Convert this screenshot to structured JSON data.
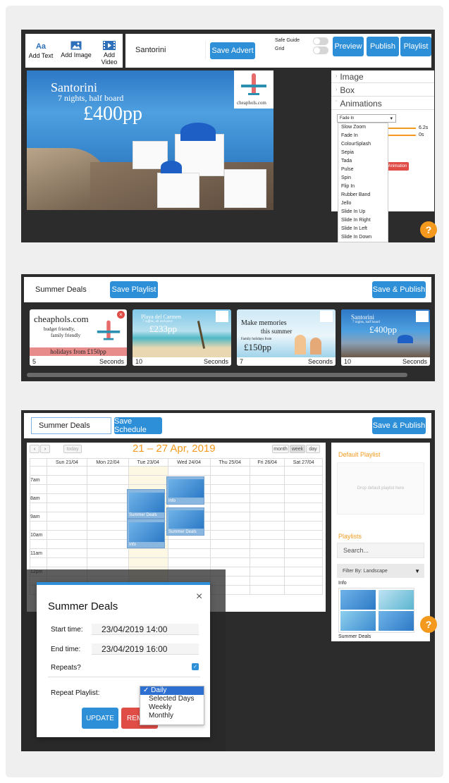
{
  "editor": {
    "tools": [
      {
        "label": "Add Text",
        "icon": "text-icon"
      },
      {
        "label": "Add Image",
        "icon": "image-icon"
      },
      {
        "label": "Add Video",
        "icon": "video-icon"
      }
    ],
    "advert_name": "Santorini",
    "save_advert": "Save Advert",
    "safe_guide": "Safe Guide",
    "grid": "Grid",
    "preview": "Preview",
    "publish": "Publish",
    "playlist": "Playlist",
    "canvas": {
      "title": "Santorini",
      "subtitle": "7 nights, half board",
      "price": "£400pp",
      "logo": "cheaphols.com"
    },
    "panel": {
      "image": "Image",
      "box": "Box",
      "animations": "Animations",
      "selected": "Fade In",
      "dur1": "6.2s",
      "dur2": "0s",
      "add_anim": "Animation",
      "options": [
        "Slow Zoom",
        "Fade In",
        "ColourSplash",
        "Sepia",
        "Tada",
        "Pulse",
        "Spin",
        "Flip In",
        "Rubber Band",
        "Jello",
        "Slide In Up",
        "Slide In Right",
        "Slide In Left",
        "Slide In Down"
      ]
    },
    "help": "?"
  },
  "playlist": {
    "name": "Summer Deals",
    "save_playlist": "Save Playlist",
    "save_publish": "Save & Publish",
    "seconds_label": "Seconds",
    "items": [
      {
        "title": "cheaphols.com",
        "line1": "budget friendly,",
        "line2": "family friendly",
        "banner": "holidays from £150pp",
        "duration": "5"
      },
      {
        "title": "Playa del Carmen",
        "line1": "7 nights, all inclusive",
        "price": "£233pp",
        "duration": "10"
      },
      {
        "title": "Make memories",
        "line1": "this summer",
        "line2": "Family holidays from",
        "price": "£150pp",
        "duration": "7"
      },
      {
        "title": "Santorini",
        "line1": "7 nights, half board",
        "price": "£400pp",
        "duration": "10"
      }
    ]
  },
  "schedule": {
    "name": "Summer Deals",
    "save_schedule": "Save Schedule",
    "save_publish": "Save & Publish",
    "today": "today",
    "range": "21 – 27 Apr, 2019",
    "views": [
      "month",
      "week",
      "day"
    ],
    "days": [
      "Sun 21/04",
      "Mon 22/04",
      "Tue 23/04",
      "Wed 24/04",
      "Thu 25/04",
      "Fri 26/04",
      "Sat 27/04"
    ],
    "times": [
      "7am",
      "8am",
      "9am",
      "10am",
      "11am",
      "12pm"
    ],
    "events": {
      "e1": "Summer Deals",
      "e2": "Info",
      "e3": "Info",
      "e4": "Summer Deals"
    },
    "sidebar": {
      "default_playlist": "Default Playlist",
      "drop_hint": "Drop default playlist here",
      "playlists": "Playlists",
      "search_placeholder": "Search...",
      "filter": "Filter By: Landscape",
      "info": "Info",
      "summer_deals": "Summer Deals"
    },
    "modal": {
      "title": "Summer Deals",
      "start_label": "Start time:",
      "start_value": "23/04/2019 14:00",
      "end_label": "End time:",
      "end_value": "23/04/2019 16:00",
      "repeats": "Repeats?",
      "repeat_playlist": "Repeat Playlist:",
      "update": "UPDATE",
      "remove": "REM",
      "options": [
        "Daily",
        "Selected Days",
        "Weekly",
        "Monthly"
      ]
    }
  },
  "colors": {
    "accent": "#2d8fd8",
    "dark": "#2c2c2c",
    "orange": "#f39a1e",
    "red": "#e04c46"
  }
}
